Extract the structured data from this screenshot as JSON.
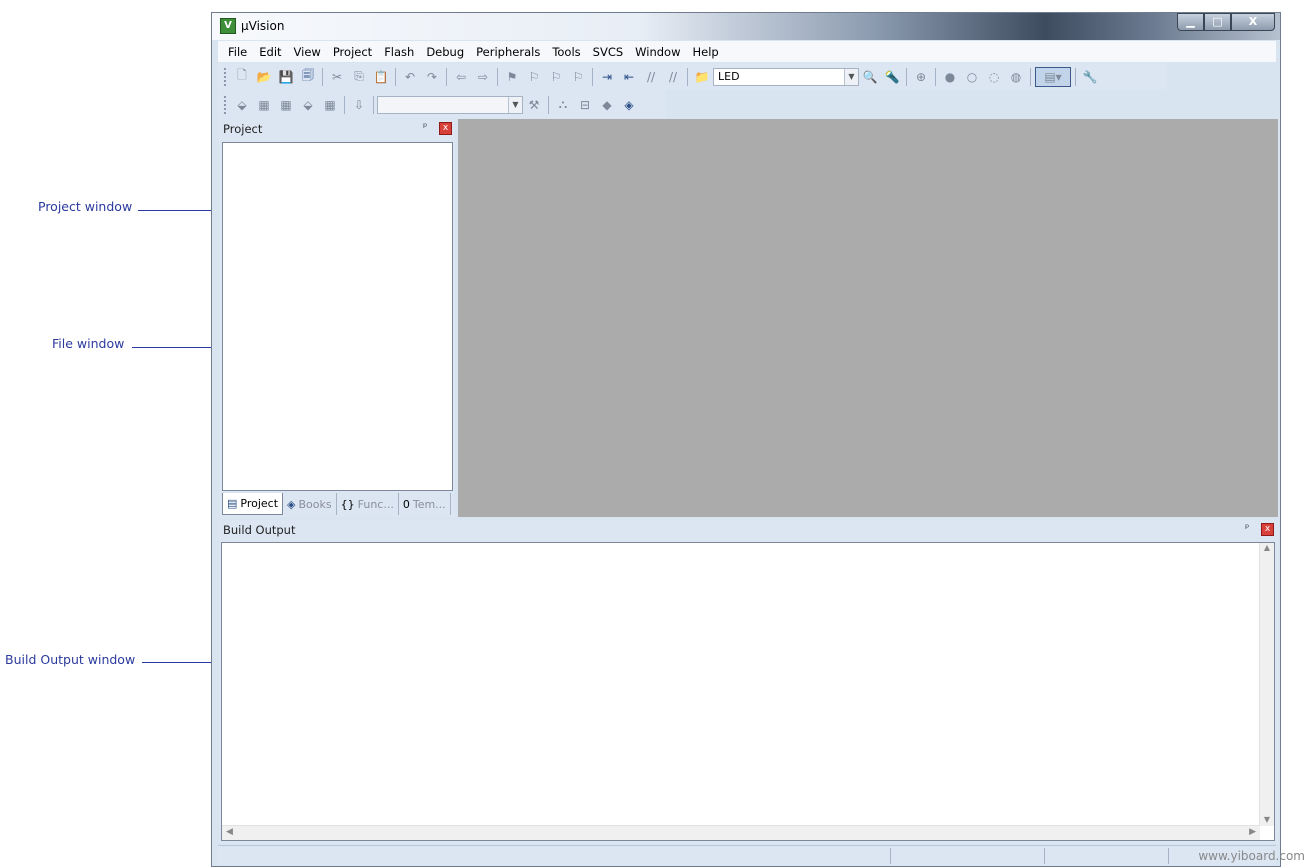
{
  "annotations": {
    "project_window": "Project window",
    "file_window": "File window",
    "build_output_window": "Build Output window"
  },
  "window": {
    "title": "µVision",
    "app_icon": "uvision-icon",
    "controls": {
      "minimize": "▁",
      "maximize": "□",
      "close": "X"
    }
  },
  "menubar": {
    "items": [
      "File",
      "Edit",
      "View",
      "Project",
      "Flash",
      "Debug",
      "Peripherals",
      "Tools",
      "SVCS",
      "Window",
      "Help"
    ]
  },
  "toolbar": {
    "target_combo_value": "LED",
    "combo_arrow": "▼",
    "toolbar2_combo_value": ""
  },
  "project_pane": {
    "title": "Project",
    "pin": "ᵖ",
    "close": "x",
    "tabs": [
      {
        "label": "Project",
        "icon": "▤"
      },
      {
        "label": "Books",
        "icon": "◈"
      },
      {
        "label": "Func...",
        "icon": "{}"
      },
      {
        "label": "Tem...",
        "icon": "0"
      }
    ]
  },
  "build_pane": {
    "title": "Build Output",
    "pin": "ᵖ",
    "close": "x",
    "scroll_up": "▲",
    "scroll_down": "▼",
    "scroll_left": "◀",
    "scroll_right": "▶"
  },
  "watermark": "www.yiboard.com",
  "colors": {
    "annotation": "#2b3a9e",
    "file_area_bg": "#ababab",
    "toolbar_bg": "#dce6f3",
    "close_red": "#d8413a"
  }
}
